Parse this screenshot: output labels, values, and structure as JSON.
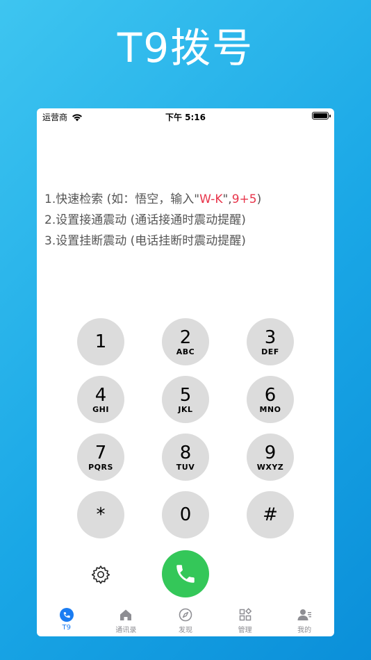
{
  "headline": "T9拨号",
  "status_bar": {
    "carrier": "运营商",
    "time": "下午 5:16"
  },
  "tips": {
    "line1_prefix": "1.快速检索 (如：悟空，输入\"",
    "line1_highlight1": "W-K",
    "line1_mid": "\",",
    "line1_highlight2": "9+5",
    "line1_suffix": ")",
    "line2": "2.设置接通震动 (通话接通时震动提醒)",
    "line3": "3.设置挂断震动 (电话挂断时震动提醒)"
  },
  "keypad": [
    {
      "digit": "1",
      "letters": ""
    },
    {
      "digit": "2",
      "letters": "ABC"
    },
    {
      "digit": "3",
      "letters": "DEF"
    },
    {
      "digit": "4",
      "letters": "GHI"
    },
    {
      "digit": "5",
      "letters": "JKL"
    },
    {
      "digit": "6",
      "letters": "MNO"
    },
    {
      "digit": "7",
      "letters": "PQRS"
    },
    {
      "digit": "8",
      "letters": "TUV"
    },
    {
      "digit": "9",
      "letters": "WXYZ"
    },
    {
      "digit": "*",
      "letters": ""
    },
    {
      "digit": "0",
      "letters": ""
    },
    {
      "digit": "#",
      "letters": ""
    }
  ],
  "tabs": [
    {
      "label": "T9",
      "icon": "phone-circle-icon",
      "active": true
    },
    {
      "label": "通讯录",
      "icon": "home-icon",
      "active": false
    },
    {
      "label": "发现",
      "icon": "compass-icon",
      "active": false
    },
    {
      "label": "管理",
      "icon": "grid-icon",
      "active": false
    },
    {
      "label": "我的",
      "icon": "person-icon",
      "active": false
    }
  ],
  "colors": {
    "accent": "#1a7cf2",
    "call": "#34c759",
    "highlight": "#e8344a",
    "key_bg": "#dcdcdc"
  }
}
